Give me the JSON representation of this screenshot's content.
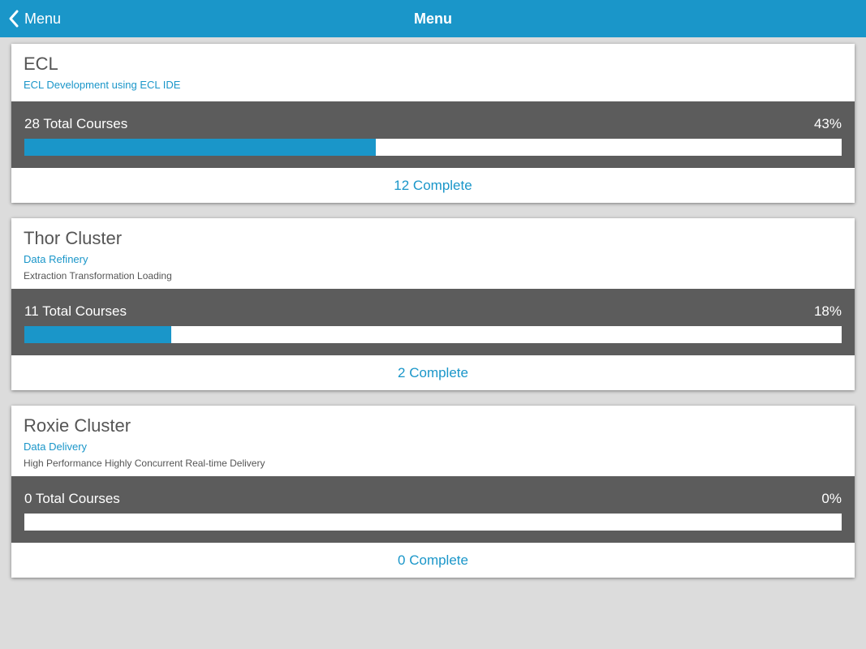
{
  "navbar": {
    "back_label": "Menu",
    "title": "Menu",
    "accent": "#1a96c9"
  },
  "cards": [
    {
      "title": "ECL",
      "subtitle": "ECL Development using ECL IDE",
      "description": "",
      "total_courses": "28 Total Courses",
      "percent_label": "43%",
      "progress": 0.43,
      "complete": "12 Complete"
    },
    {
      "title": "Thor Cluster",
      "subtitle": "Data Refinery",
      "description": "Extraction Transformation Loading",
      "total_courses": "11 Total Courses",
      "percent_label": "18%",
      "progress": 0.18,
      "complete": "2 Complete"
    },
    {
      "title": "Roxie Cluster",
      "subtitle": "Data Delivery",
      "description": "High Performance Highly Concurrent Real-time Delivery",
      "total_courses": "0 Total Courses",
      "percent_label": "0%",
      "progress": 0,
      "complete": "0 Complete"
    }
  ]
}
